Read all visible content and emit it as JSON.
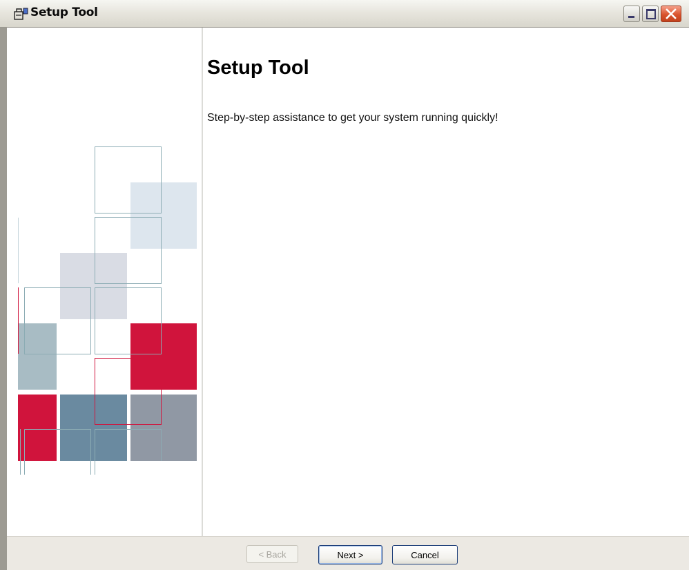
{
  "window": {
    "title": "Setup Tool"
  },
  "titlebar": {
    "icon": "setup-tool-app-icon",
    "controls": [
      "minimize-icon",
      "maximize-icon",
      "close-icon"
    ]
  },
  "main": {
    "heading": "Setup Tool",
    "subtitle": "Step-by-step assistance to get your system running quickly!"
  },
  "buttons": {
    "back": "< Back",
    "next": "Next >",
    "cancel": "Cancel"
  },
  "colors": {
    "accent_red": "#d0143c",
    "slate_blue": "#6a8aa0",
    "grey_blue": "#9098a4",
    "light_blue": "#dde6ee",
    "teal_grey": "#a8bcc4"
  }
}
